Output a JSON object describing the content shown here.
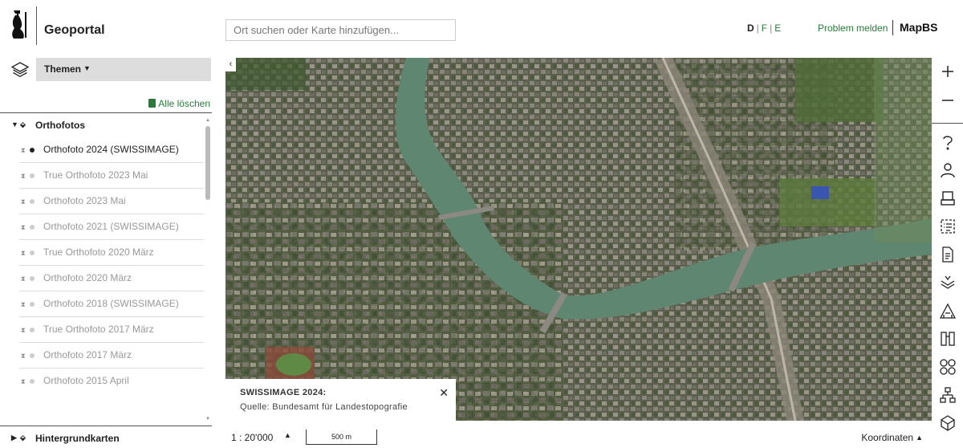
{
  "header": {
    "brand": "Geoportal",
    "search_placeholder": "Ort suchen oder Karte hinzufügen...",
    "languages": [
      "D",
      "F",
      "E"
    ],
    "active_language": "D",
    "report_link": "Problem melden",
    "mapbs": "MapBS"
  },
  "sidebar": {
    "themes_label": "Themen",
    "delete_all": "Alle löschen",
    "group_orthofotos": "Orthofotos",
    "items": [
      {
        "label": "Orthofoto 2024 (SWISSIMAGE)",
        "active": true
      },
      {
        "label": "True Orthofoto 2023 Mai",
        "active": false
      },
      {
        "label": "Orthofoto 2023 Mai",
        "active": false
      },
      {
        "label": "Orthofoto 2021 (SWISSIMAGE)",
        "active": false
      },
      {
        "label": "True Orthofoto 2020 März",
        "active": false
      },
      {
        "label": "Orthofoto 2020 März",
        "active": false
      },
      {
        "label": "Orthofoto 2018 (SWISSIMAGE)",
        "active": false
      },
      {
        "label": "True Orthofoto 2017 März",
        "active": false
      },
      {
        "label": "Orthofoto 2017 März",
        "active": false
      },
      {
        "label": "Orthofoto 2015 April",
        "active": false
      }
    ],
    "group_backgrounds": "Hintergrundkarten"
  },
  "attribution": {
    "title": "SWISSIMAGE 2024:",
    "source": "Quelle: Bundesamt für Landestopografie"
  },
  "footer": {
    "scale": "1 : 20'000",
    "scalebar": "500 m",
    "coordinates": "Koordinaten"
  },
  "toolbar_icons": [
    "zoom-in-icon",
    "zoom-out-icon",
    "help-icon",
    "user-icon",
    "print-icon",
    "legend-icon",
    "document-icon",
    "layers-stack-icon",
    "measure-icon",
    "book-icon",
    "tools-icon",
    "network-icon",
    "3d-icon"
  ]
}
